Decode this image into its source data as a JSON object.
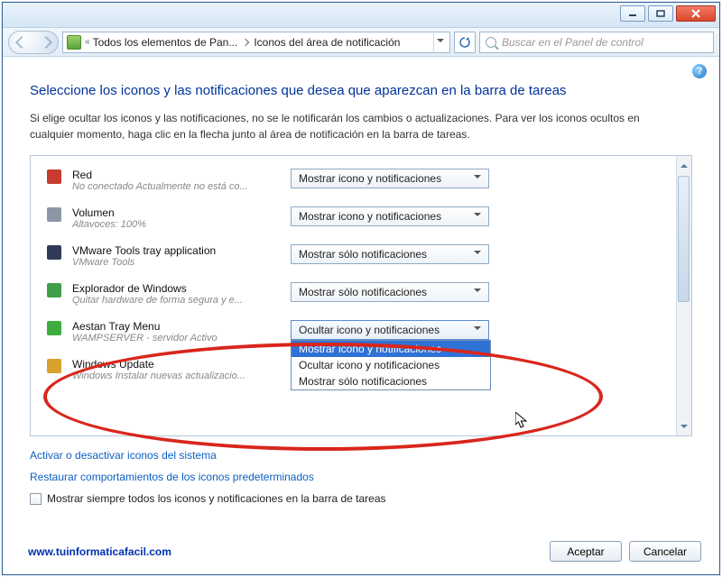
{
  "breadcrumb": {
    "root": "Todos los elementos de Pan...",
    "current": "Iconos del área de notificación"
  },
  "search": {
    "placeholder": "Buscar en el Panel de control"
  },
  "heading": "Seleccione los iconos y las notificaciones que desea que aparezcan en la barra de tareas",
  "description": "Si elige ocultar los iconos y las notificaciones, no se le notificarán los cambios o actualizaciones. Para ver los iconos ocultos en cualquier momento, haga clic en la flecha junto al área de notificación en la barra de tareas.",
  "options": {
    "show_all": "Mostrar icono y notificaciones",
    "hide": "Ocultar icono y notificaciones",
    "notify_only": "Mostrar sólo notificaciones"
  },
  "rows": [
    {
      "title": "Red",
      "subtitle": "No conectado Actualmente no está co...",
      "value_key": "show_all",
      "iconColor": "#c83b2e"
    },
    {
      "title": "Volumen",
      "subtitle": "Altavoces: 100%",
      "value_key": "show_all",
      "iconColor": "#8b97a4"
    },
    {
      "title": "VMware Tools tray application",
      "subtitle": "VMware Tools",
      "value_key": "notify_only",
      "iconColor": "#2f3b57"
    },
    {
      "title": "Explorador de Windows",
      "subtitle": "Quitar hardware de forma segura y e...",
      "value_key": "notify_only",
      "iconColor": "#3fa049"
    },
    {
      "title": "Aestan Tray Menu",
      "subtitle": "WAMPSERVER - servidor Activo",
      "value_key": "hide",
      "iconColor": "#3cae3f",
      "open": true
    },
    {
      "title": "Windows Update",
      "subtitle": "Windows Instalar nuevas actualizacio...",
      "value_key": "show_all",
      "iconColor": "#d9a12d"
    }
  ],
  "dropdown_order": [
    "show_all",
    "hide",
    "notify_only"
  ],
  "links": {
    "system_icons": "Activar o desactivar iconos del sistema",
    "restore": "Restaurar comportamientos de los iconos predeterminados"
  },
  "checkbox_label": "Mostrar siempre todos los iconos y notificaciones en la barra de tareas",
  "footer": {
    "url": "www.tuinformaticafacil.com",
    "accept": "Aceptar",
    "cancel": "Cancelar"
  },
  "help_glyph": "?"
}
